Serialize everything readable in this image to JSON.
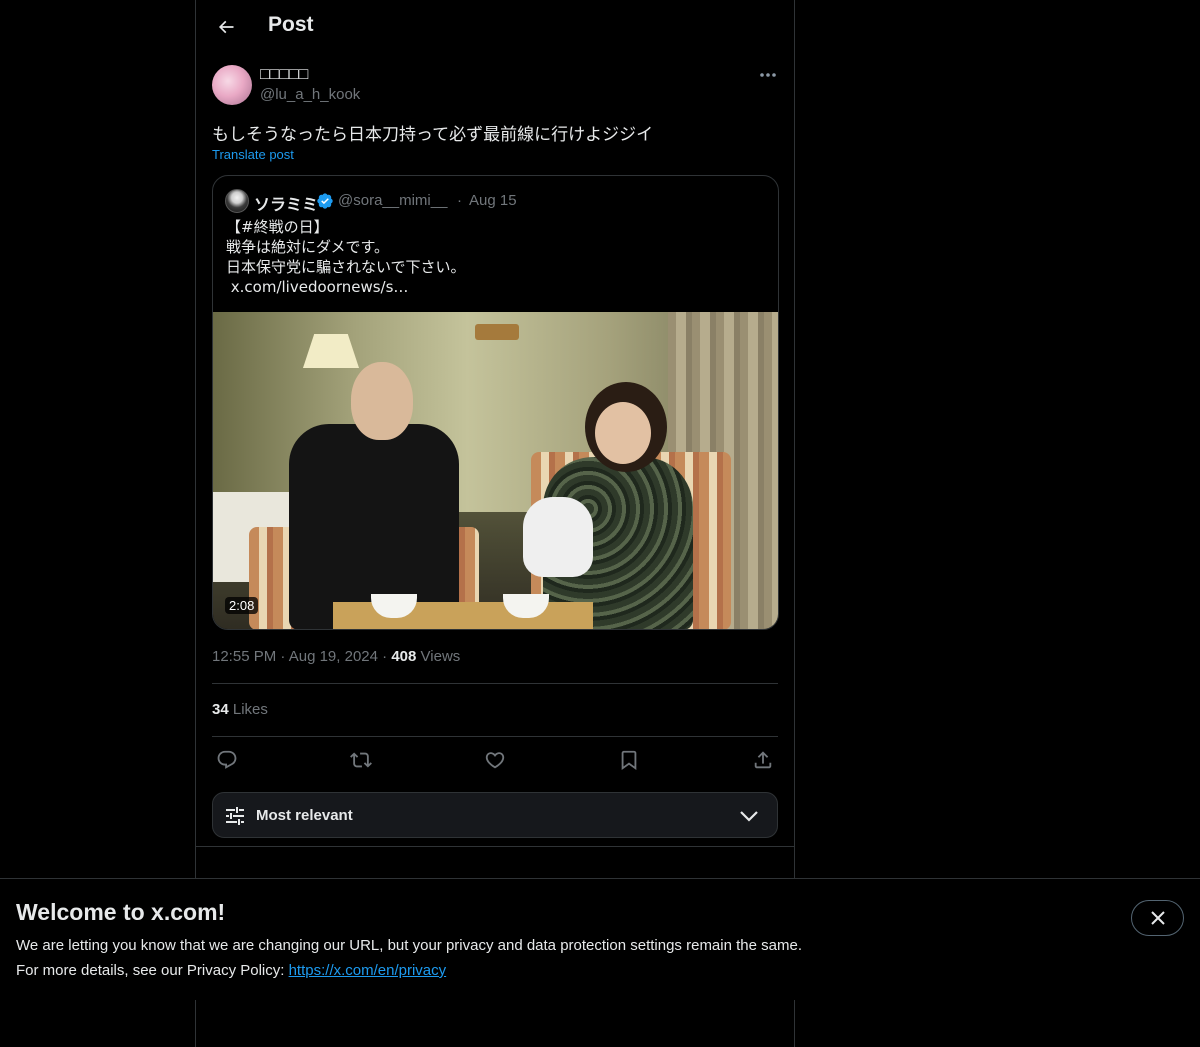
{
  "header": {
    "title": "Post"
  },
  "author": {
    "display_name": "□□□□□",
    "handle": "@lu_a_h_kook"
  },
  "post": {
    "text": "もしそうなったら日本刀持って必ず最前線に行けよジジイ",
    "translate_label": "Translate post"
  },
  "quote": {
    "display_name": "ソラミミ",
    "handle": "@sora__mimi__",
    "separator": "·",
    "date": "Aug 15",
    "lines": [
      "【#終戦の日】",
      "戦争は絶対にダメです。",
      "日本保守党に騙されないで下さい。",
      " x.com/livedoornews/s…"
    ],
    "video_duration": "2:08"
  },
  "meta": {
    "time": "12:55 PM",
    "separator": "·",
    "date": "Aug 19, 2024",
    "views_count": "408",
    "views_label": "Views"
  },
  "likes": {
    "count": "34",
    "label": "Likes"
  },
  "actions": [
    "reply-icon",
    "repost-icon",
    "like-icon",
    "bookmark-icon",
    "share-icon"
  ],
  "sort": {
    "label": "Most relevant"
  },
  "banner": {
    "title": "Welcome to x.com!",
    "line1": "We are letting you know that we are changing our URL, but your privacy and data protection settings remain the same.",
    "line2_prefix": "For more details, see our Privacy Policy: ",
    "link": "https://x.com/en/privacy"
  },
  "colors": {
    "accent": "#1d9bf0",
    "text": "#e7e9ea",
    "muted": "#71767b",
    "border": "#2f3336",
    "background": "#000000"
  }
}
